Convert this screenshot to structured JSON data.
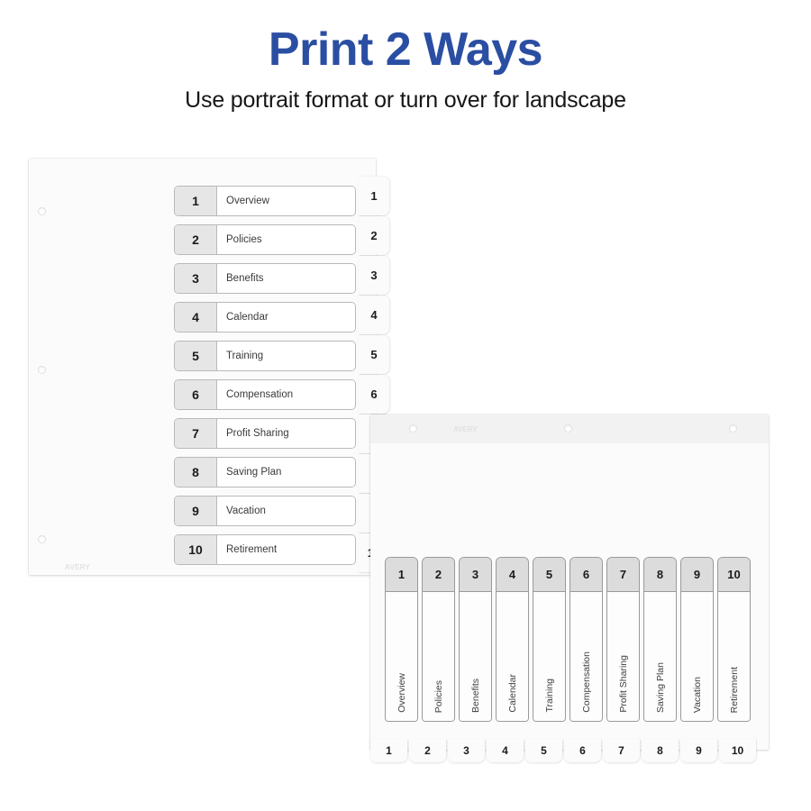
{
  "header": {
    "title": "Print 2 Ways",
    "subtitle": "Use portrait format or turn over for landscape",
    "title_color": "#2a4ea2",
    "subtitle_color": "#161616"
  },
  "brand": {
    "logo_text": "AVERY"
  },
  "dividers": [
    {
      "number": "1",
      "label": "Overview"
    },
    {
      "number": "2",
      "label": "Policies"
    },
    {
      "number": "3",
      "label": "Benefits"
    },
    {
      "number": "4",
      "label": "Calendar"
    },
    {
      "number": "5",
      "label": "Training"
    },
    {
      "number": "6",
      "label": "Compensation"
    },
    {
      "number": "7",
      "label": "Profit Sharing"
    },
    {
      "number": "8",
      "label": "Saving Plan"
    },
    {
      "number": "9",
      "label": "Vacation"
    },
    {
      "number": "10",
      "label": "Retirement"
    }
  ],
  "portrait_sheet": {
    "orientation": "portrait",
    "hole_count": 3,
    "tab_edge": "right"
  },
  "landscape_sheet": {
    "orientation": "landscape",
    "hole_count": 3,
    "tab_edge": "bottom"
  }
}
